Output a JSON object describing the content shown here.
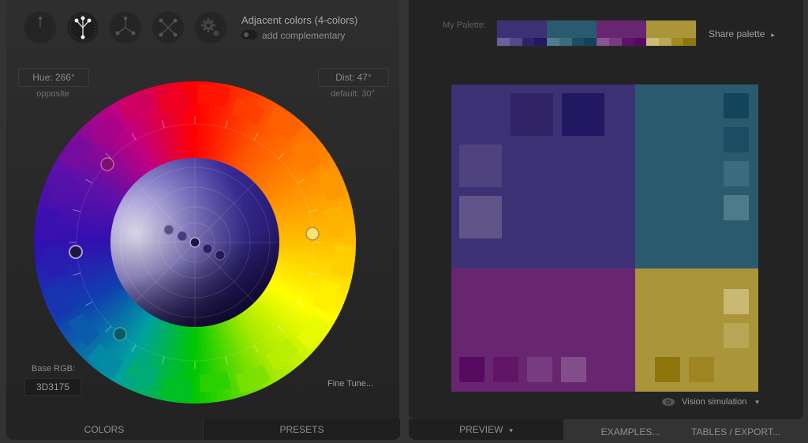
{
  "scheme_selector": {
    "options": [
      {
        "name": "mono",
        "label": "Monochromatic"
      },
      {
        "name": "adjacent",
        "label": "Adjacent",
        "active": true
      },
      {
        "name": "triad",
        "label": "Triad"
      },
      {
        "name": "tetrad",
        "label": "Tetrad"
      },
      {
        "name": "custom",
        "label": "Custom"
      }
    ]
  },
  "scheme": {
    "title": "Adjacent colors (4-colors)",
    "complementary_label": "add complementary",
    "complementary_on": false
  },
  "hue": {
    "label": "Hue: 266°",
    "sublabel": "opposite"
  },
  "dist": {
    "label": "Dist: 47°",
    "sublabel": "default: 30°"
  },
  "base": {
    "label": "Base RGB:",
    "value": "3D3175"
  },
  "fine_tune": "Fine Tune...",
  "left_tabs": {
    "colors": "COLORS",
    "presets": "PRESETS"
  },
  "palette": {
    "label": "My Palette:",
    "share_label": "Share palette",
    "groups": [
      {
        "main": "#3D3175",
        "shades": [
          "#6B609E",
          "#544889",
          "#2F2366",
          "#221761"
        ]
      },
      {
        "main": "#2A5A6E",
        "shades": [
          "#4F7D8E",
          "#3C6B7D",
          "#1D4D62",
          "#0F435A"
        ]
      },
      {
        "main": "#682671",
        "shades": [
          "#8A5491",
          "#773C80",
          "#5E1466",
          "#560A60"
        ]
      },
      {
        "main": "#AA953A",
        "shades": [
          "#CDBC72",
          "#BBA756",
          "#A0891E",
          "#8E760D"
        ]
      }
    ]
  },
  "preview": {
    "primary": {
      "color": "#3D3175",
      "swatches": [
        "#312466",
        "#221761",
        "#4F437E",
        "#5F5589"
      ]
    },
    "secondary": {
      "color": "#2A5A6E",
      "swatches": [
        "#12445A",
        "#1D4D62",
        "#3C6B7D",
        "#4E7A8B"
      ]
    },
    "tertiary": {
      "color": "#682671",
      "swatches": [
        "#560A60",
        "#621467",
        "#773C80",
        "#824E8A"
      ]
    },
    "accent": {
      "color": "#AA953A",
      "swatches": [
        "#C9B972",
        "#B9A654",
        "#8E760D",
        "#9E8522"
      ]
    }
  },
  "vision_label": "Vision simulation",
  "right_tabs": {
    "preview": "PREVIEW",
    "examples": "EXAMPLES...",
    "tables": "TABLES / EXPORT..."
  }
}
